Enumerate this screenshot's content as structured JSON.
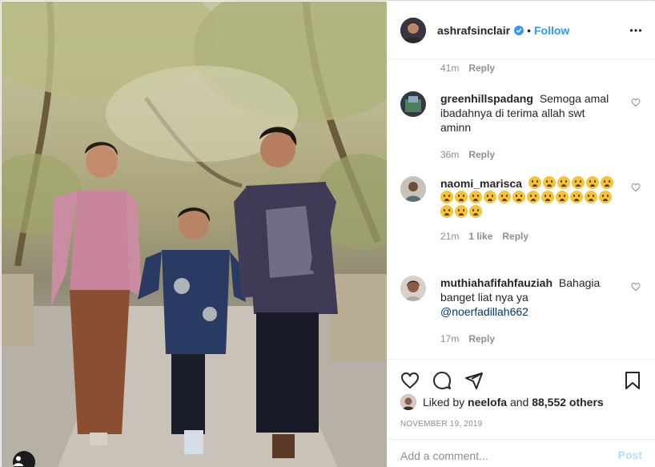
{
  "header": {
    "username": "ashrafsinclair",
    "dot": "•",
    "follow_label": "Follow",
    "icons": {
      "verified": "verified-badge-icon",
      "more": "more-options-icon"
    }
  },
  "comments": [
    {
      "username": "",
      "text": "",
      "time": "41m",
      "likes": "",
      "reply": "Reply"
    },
    {
      "username": "greenhillspadang",
      "text": "Semoga amal ibadahnya di terima allah swt aminn",
      "time": "36m",
      "likes": "",
      "reply": "Reply"
    },
    {
      "username": "naomi_marisca",
      "text": "",
      "emoji_count": 21,
      "emoji_name": "crying-face-emoji",
      "time": "21m",
      "likes": "1 like",
      "reply": "Reply"
    },
    {
      "username": "muthiahafifahfauziah",
      "text": "Bahagia banget liat nya ya",
      "mention": "@noerfadillah662",
      "time": "17m",
      "likes": "",
      "reply": "Reply"
    }
  ],
  "actions": {
    "icons": [
      "heart-icon",
      "comment-icon",
      "share-icon",
      "bookmark-icon"
    ]
  },
  "likes": {
    "prefix": "Liked by ",
    "user": "neelofa",
    "middle": " and ",
    "count": "88,552 others"
  },
  "date": "NOVEMBER 19, 2019",
  "add_comment": {
    "placeholder": "Add a comment...",
    "post_label": "Post"
  },
  "colors": {
    "link_blue": "#3897f0",
    "post_disabled": "#b2dffc",
    "muted": "#8e8e8e",
    "text": "#262626"
  }
}
